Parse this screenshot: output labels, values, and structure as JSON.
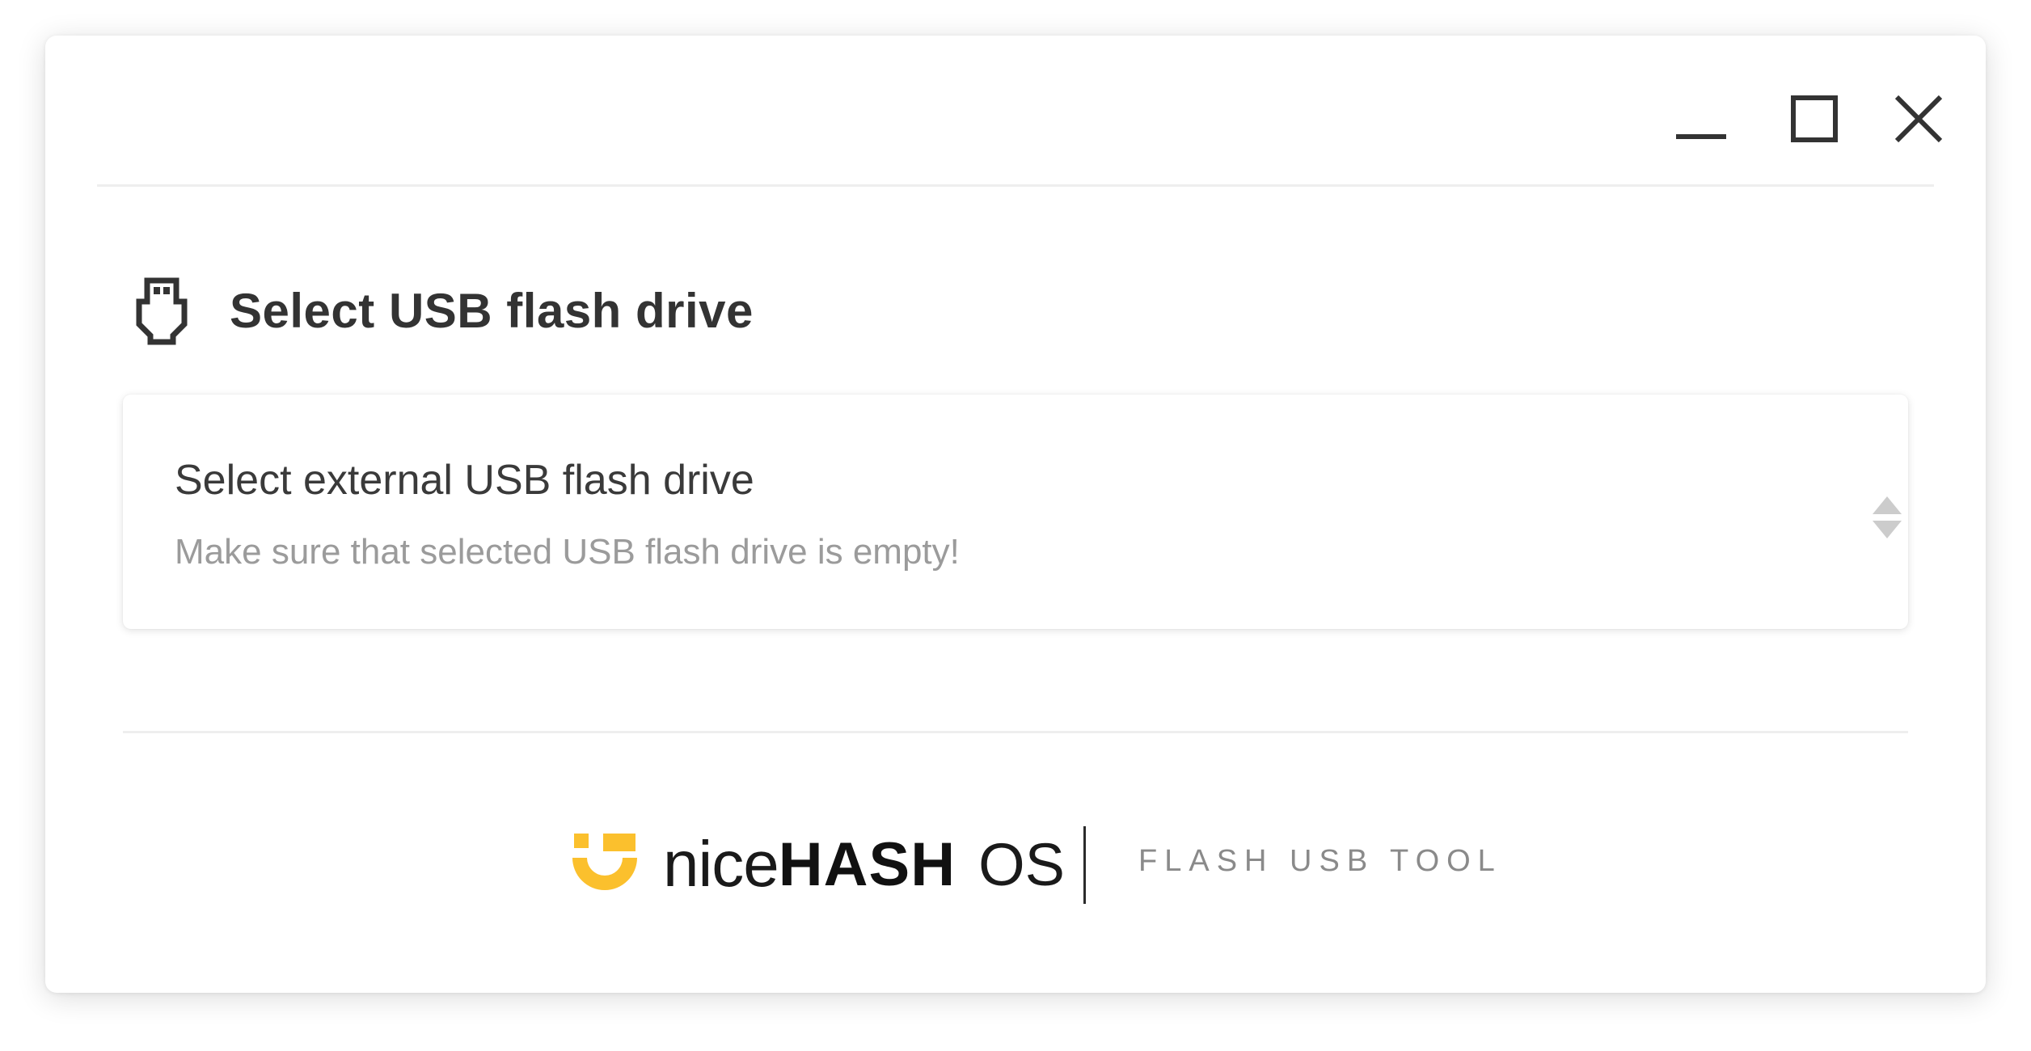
{
  "window": {
    "controls": {
      "minimize_icon": "minimize-icon",
      "maximize_icon": "maximize-icon",
      "close_icon": "close-icon"
    }
  },
  "section": {
    "icon": "usb-icon",
    "title": "Select USB flash drive"
  },
  "drive_select": {
    "label": "Select external USB flash drive",
    "hint": "Make sure that selected USB flash drive is empty!",
    "icon": "select-arrows-icon"
  },
  "footer": {
    "logo": {
      "nice": "nice",
      "hash": "HASH",
      "os": "OS",
      "mark_color": "#fbc02d"
    },
    "tool_label": "FLASH USB TOOL"
  },
  "colors": {
    "text_primary": "#333333",
    "text_secondary": "#9b9b9b",
    "accent": "#fbc02d",
    "divider": "#eeeeee"
  }
}
